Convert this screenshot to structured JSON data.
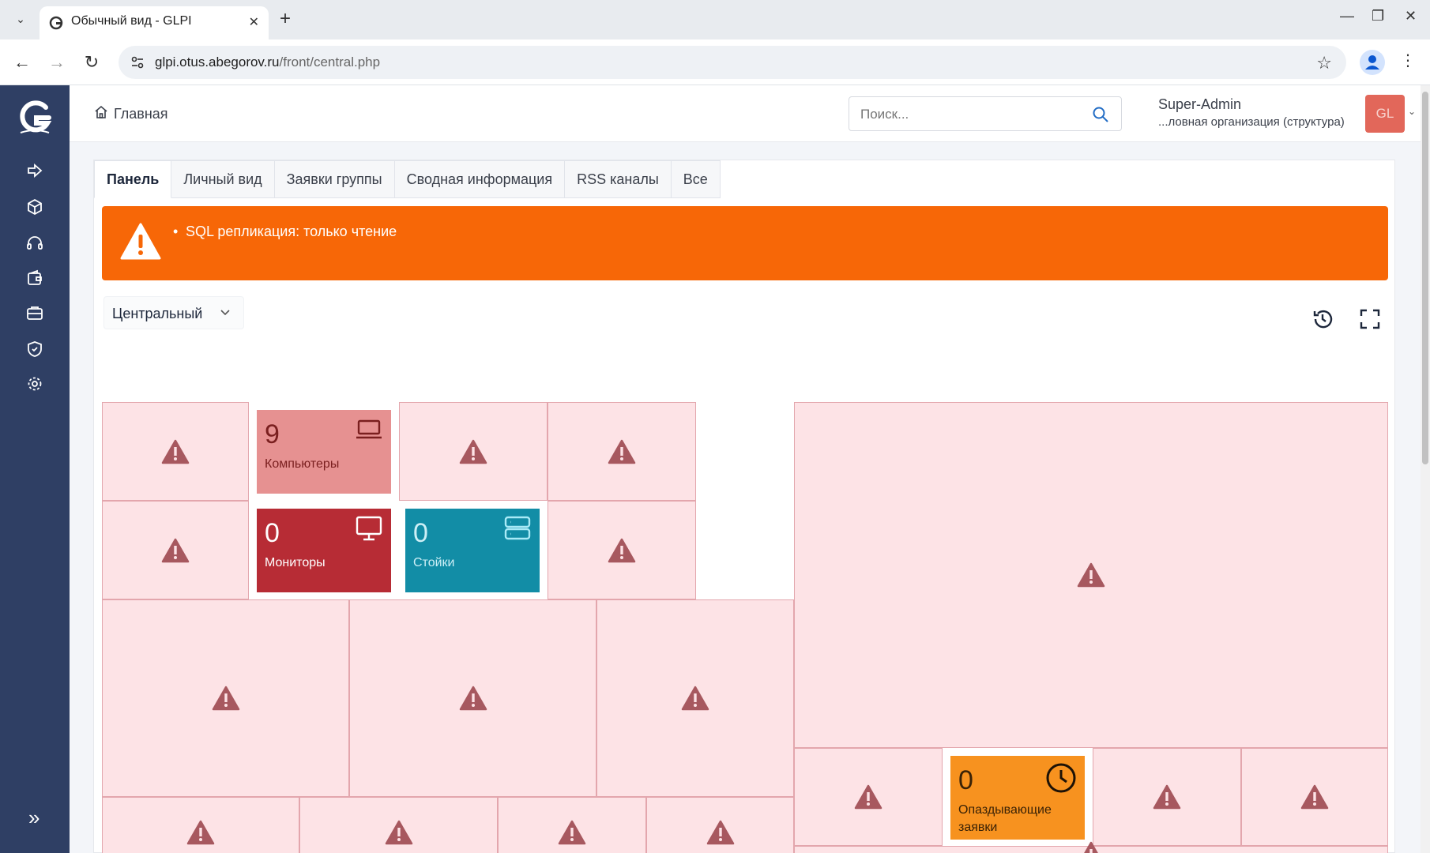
{
  "browser": {
    "tab_title": "Обычный вид - GLPI",
    "url_host": "glpi.otus.abegorov.ru",
    "url_path": "/front/central.php"
  },
  "sidebar": {
    "items": [
      {
        "name": "forward-icon"
      },
      {
        "name": "box-icon"
      },
      {
        "name": "headset-icon"
      },
      {
        "name": "wallet-icon"
      },
      {
        "name": "briefcase-icon"
      },
      {
        "name": "shield-icon"
      },
      {
        "name": "gear-icon"
      }
    ],
    "collapse_glyph": "»"
  },
  "header": {
    "breadcrumb": "Главная",
    "search_placeholder": "Поиск...",
    "user_name": "Super-Admin",
    "user_entity": "...ловная организация (структура)",
    "avatar_initials": "GL"
  },
  "tabs": [
    "Панель",
    "Личный вид",
    "Заявки группы",
    "Сводная информация",
    "RSS каналы",
    "Все"
  ],
  "active_tab": "Панель",
  "alert": {
    "message": "SQL репликация: только чтение",
    "color": "#f76707"
  },
  "dashboard": {
    "selected": "Центральный"
  },
  "cards": {
    "computers": {
      "value": "9",
      "label": "Компьютеры",
      "color": "#e69191",
      "text_color": "#7a1f1f",
      "icon": "laptop-icon"
    },
    "monitors": {
      "value": "0",
      "label": "Мониторы",
      "color": "#b72c35",
      "text_color": "#ffffff",
      "icon": "monitor-icon"
    },
    "racks": {
      "value": "0",
      "label": "Стойки",
      "color": "#128da6",
      "text_color": "#cdeff6",
      "icon": "server-icon"
    },
    "late_tickets": {
      "value": "0",
      "label": "Опаздывающие заявки",
      "color": "#f7921f",
      "text_color": "#3a2206",
      "icon": "clock-icon"
    }
  }
}
